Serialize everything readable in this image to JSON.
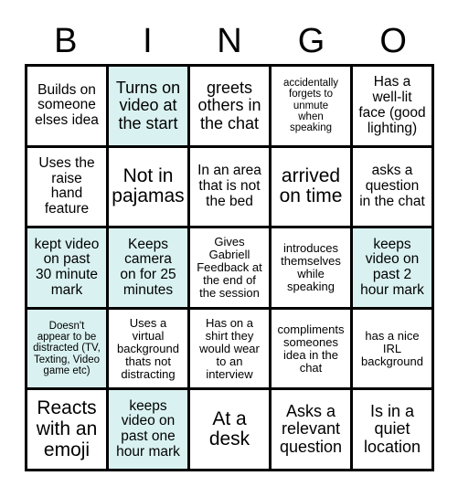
{
  "card": {
    "header_letters": [
      "B",
      "I",
      "N",
      "G",
      "O"
    ],
    "marked_color": "#d9f2f1",
    "border_color": "#000000",
    "background_color": "#ffffff",
    "columns": 5,
    "rows": 5,
    "cells": [
      {
        "text": "Builds on\nsomeone\nelses idea",
        "marked": false,
        "size": "md"
      },
      {
        "text": "Turns on\nvideo at\nthe start",
        "marked": true,
        "size": "lg"
      },
      {
        "text": "greets\nothers in\nthe chat",
        "marked": false,
        "size": "lg"
      },
      {
        "text": "accidentally\nforgets to\nunmute\nwhen\nspeaking",
        "marked": false,
        "size": "xs"
      },
      {
        "text": "Has a\nwell-lit\nface (good\nlighting)",
        "marked": false,
        "size": "md"
      },
      {
        "text": "Uses the\nraise\nhand\nfeature",
        "marked": false,
        "size": "md"
      },
      {
        "text": "Not in\npajamas",
        "marked": false,
        "size": "xl"
      },
      {
        "text": "In an area\nthat is not\nthe bed",
        "marked": false,
        "size": "md"
      },
      {
        "text": "arrived\non time",
        "marked": false,
        "size": "xl"
      },
      {
        "text": "asks a\nquestion\nin the chat",
        "marked": false,
        "size": "md"
      },
      {
        "text": "kept video\non past\n30 minute\nmark",
        "marked": true,
        "size": "md"
      },
      {
        "text": "Keeps\ncamera\non for 25\nminutes",
        "marked": true,
        "size": "md"
      },
      {
        "text": "Gives\nGabriell\nFeedback at\nthe end of\nthe session",
        "marked": false,
        "size": "sm"
      },
      {
        "text": "introduces\nthemselves\nwhile\nspeaking",
        "marked": false,
        "size": "sm"
      },
      {
        "text": "keeps\nvideo on\npast 2\nhour mark",
        "marked": true,
        "size": "md"
      },
      {
        "text": "Doesn't\nappear to be\ndistracted (TV,\nTexting, Video\ngame etc)",
        "marked": true,
        "size": "xs"
      },
      {
        "text": "Uses a\nvirtual\nbackground\nthats not\ndistracting",
        "marked": false,
        "size": "sm"
      },
      {
        "text": "Has on a\nshirt they\nwould wear\nto an\ninterview",
        "marked": false,
        "size": "sm"
      },
      {
        "text": "compliments\nsomeones\nidea in the\nchat",
        "marked": false,
        "size": "sm"
      },
      {
        "text": "has a nice\nIRL\nbackground",
        "marked": false,
        "size": "sm"
      },
      {
        "text": "Reacts\nwith an\nemoji",
        "marked": false,
        "size": "xl"
      },
      {
        "text": "keeps\nvideo on\npast one\nhour mark",
        "marked": true,
        "size": "md"
      },
      {
        "text": "At a\ndesk",
        "marked": false,
        "size": "xl"
      },
      {
        "text": "Asks a\nrelevant\nquestion",
        "marked": false,
        "size": "lg"
      },
      {
        "text": "Is in a\nquiet\nlocation",
        "marked": false,
        "size": "lg"
      }
    ]
  }
}
